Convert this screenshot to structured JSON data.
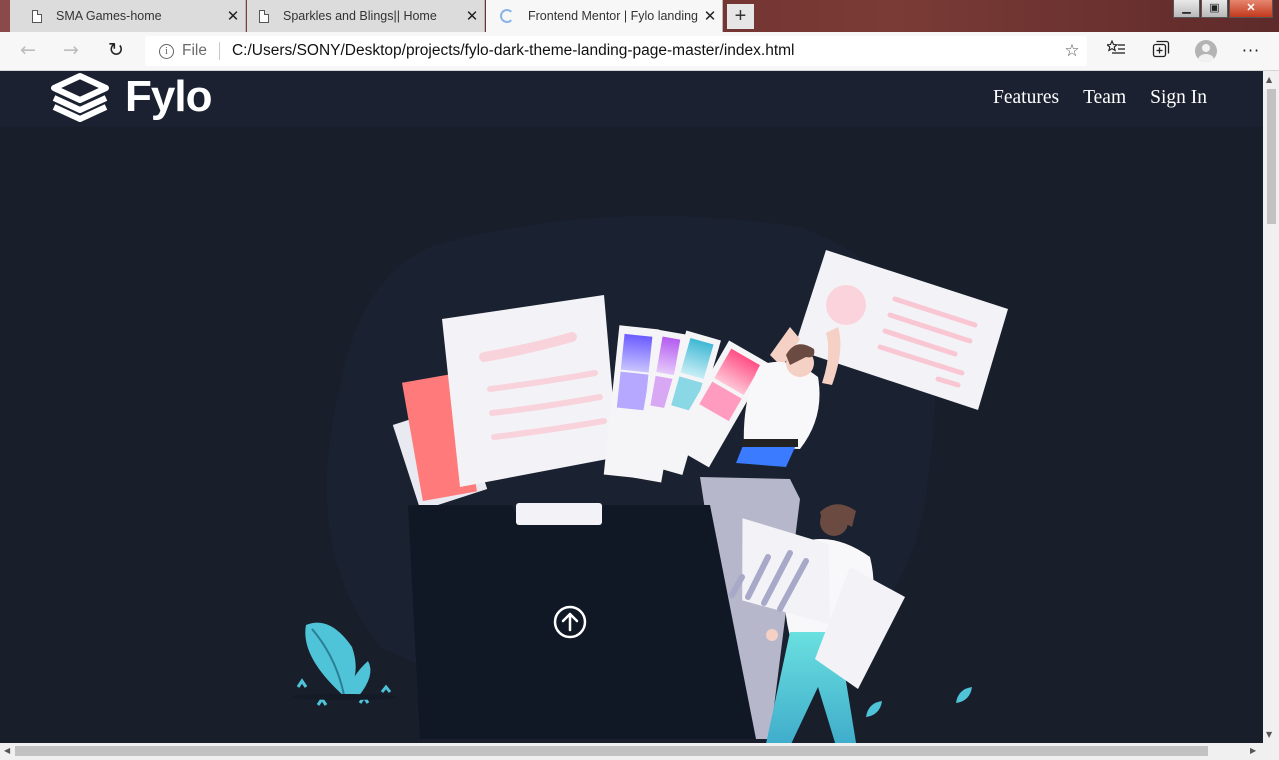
{
  "browser": {
    "tabs": [
      {
        "title": "SMA Games-home",
        "active": false
      },
      {
        "title": "Sparkles and Blings|| Home",
        "active": false
      },
      {
        "title": "Frontend Mentor | Fylo landing p",
        "active": true
      }
    ],
    "new_tab": "+",
    "window_controls": {
      "minimize": "▁",
      "maximize": "▣",
      "close": "✕"
    },
    "address_bar": {
      "scheme": "File",
      "url": "C:/Users/SONY/Desktop/projects/fylo-dark-theme-landing-page-master/index.html"
    },
    "icons": [
      "back-arrow-icon",
      "forward-arrow-icon",
      "refresh-icon",
      "info-icon",
      "favorite-star-icon",
      "favorites-list-icon",
      "collections-icon",
      "profile-icon",
      "more-menu-icon"
    ]
  },
  "site": {
    "logo_text": "Fylo",
    "nav": [
      {
        "label": "Features"
      },
      {
        "label": "Team"
      },
      {
        "label": "Sign In"
      }
    ]
  },
  "colors": {
    "page_bg": "#1c2230",
    "header_bg": "#1b2130",
    "hero_bg": "#181e2a",
    "accent_cyan": "#4fc3d8",
    "accent_pink": "#f15f79"
  }
}
